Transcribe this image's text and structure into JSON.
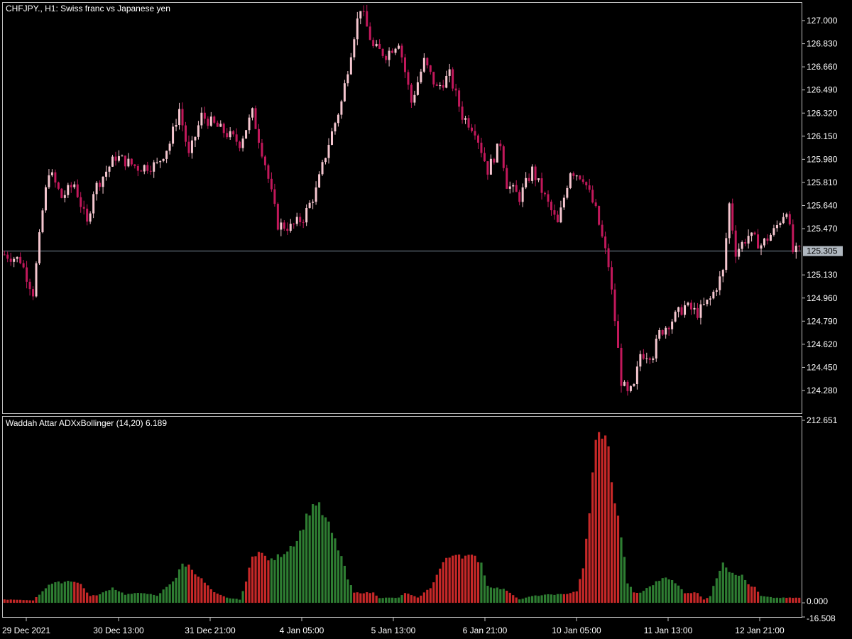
{
  "title": {
    "symbol": "CHFJPY.",
    "timeframe": "H1",
    "description": "Swiss franc vs Japanese yen"
  },
  "colors": {
    "background": "#000000",
    "bull_candle": "#F5C6CF",
    "bear_candle": "#C2185B",
    "histogram_up": "#2E7D32",
    "histogram_down": "#C62828",
    "price_line": "#7A8A9A",
    "current_price_bg": "#B0B8C0"
  },
  "current_price_label": "125.305",
  "chart_data": [
    {
      "type": "candlestick",
      "title": "CHFJPY., H1:  Swiss franc vs Japanese yen",
      "ylim": [
        124.15,
        127.1
      ],
      "y_ticks": [
        "127.000",
        "126.830",
        "126.660",
        "126.490",
        "126.320",
        "126.150",
        "125.980",
        "125.810",
        "125.640",
        "125.470",
        "125.130",
        "124.960",
        "124.790",
        "124.620",
        "124.450",
        "124.280"
      ],
      "x_ticks": [
        "29 Dec 2021",
        "30 Dec 13:00",
        "31 Dec 21:00",
        "4 Jan 05:00",
        "5 Jan 13:00",
        "6 Jan 21:00",
        "10 Jan 05:00",
        "11 Jan 13:00",
        "12 Jan 21:00"
      ],
      "current_price": 125.305,
      "close_path": [
        [
          0,
          125.28
        ],
        [
          5,
          125.24
        ],
        [
          9,
          125.0
        ],
        [
          12,
          125.6
        ],
        [
          14,
          125.9
        ],
        [
          18,
          125.7
        ],
        [
          22,
          125.8
        ],
        [
          26,
          125.5
        ],
        [
          28,
          125.75
        ],
        [
          35,
          126.0
        ],
        [
          42,
          125.92
        ],
        [
          48,
          125.94
        ],
        [
          52,
          126.1
        ],
        [
          55,
          126.35
        ],
        [
          58,
          126.0
        ],
        [
          62,
          126.3
        ],
        [
          68,
          126.2
        ],
        [
          74,
          126.1
        ],
        [
          78,
          126.32
        ],
        [
          82,
          125.95
        ],
        [
          86,
          125.5
        ],
        [
          90,
          125.48
        ],
        [
          94,
          125.55
        ],
        [
          98,
          125.75
        ],
        [
          102,
          126.1
        ],
        [
          106,
          126.4
        ],
        [
          110,
          126.9
        ],
        [
          112,
          127.1
        ],
        [
          116,
          126.8
        ],
        [
          120,
          126.75
        ],
        [
          124,
          126.85
        ],
        [
          128,
          126.4
        ],
        [
          132,
          126.7
        ],
        [
          136,
          126.5
        ],
        [
          140,
          126.6
        ],
        [
          144,
          126.3
        ],
        [
          148,
          126.2
        ],
        [
          152,
          125.9
        ],
        [
          156,
          126.1
        ],
        [
          158,
          125.8
        ],
        [
          162,
          125.7
        ],
        [
          166,
          125.9
        ],
        [
          170,
          125.7
        ],
        [
          174,
          125.5
        ],
        [
          178,
          125.9
        ],
        [
          182,
          125.85
        ],
        [
          186,
          125.6
        ],
        [
          190,
          125.2
        ],
        [
          192,
          124.8
        ],
        [
          194,
          124.35
        ],
        [
          196,
          124.25
        ],
        [
          198,
          124.3
        ],
        [
          200,
          124.55
        ],
        [
          204,
          124.55
        ],
        [
          206,
          124.7
        ],
        [
          210,
          124.8
        ],
        [
          214,
          124.9
        ],
        [
          218,
          124.85
        ],
        [
          222,
          124.95
        ],
        [
          226,
          125.15
        ],
        [
          228,
          125.65
        ],
        [
          230,
          125.3
        ],
        [
          234,
          125.42
        ],
        [
          238,
          125.35
        ],
        [
          242,
          125.45
        ],
        [
          246,
          125.62
        ],
        [
          248,
          125.3
        ],
        [
          250,
          125.3
        ]
      ]
    },
    {
      "type": "bar",
      "title": "Waddah Attar ADXxBollinger (14,20) 6.189",
      "ylim": [
        -16.508,
        212.651
      ],
      "y_ticks": [
        "212.651",
        "0.000",
        "-16.508"
      ],
      "last_value": 6.189,
      "envelope": [
        [
          0,
          4,
          -1
        ],
        [
          9,
          3,
          -1
        ],
        [
          11,
          10,
          1
        ],
        [
          14,
          22,
          1
        ],
        [
          20,
          26,
          1
        ],
        [
          22,
          26,
          -1
        ],
        [
          24,
          22,
          -1
        ],
        [
          27,
          8,
          -1
        ],
        [
          30,
          10,
          1
        ],
        [
          34,
          18,
          1
        ],
        [
          38,
          10,
          1
        ],
        [
          44,
          12,
          1
        ],
        [
          48,
          8,
          1
        ],
        [
          54,
          30,
          1
        ],
        [
          56,
          46,
          1
        ],
        [
          58,
          44,
          -1
        ],
        [
          62,
          28,
          -1
        ],
        [
          66,
          12,
          -1
        ],
        [
          70,
          6,
          1
        ],
        [
          74,
          4,
          1
        ],
        [
          76,
          24,
          -1
        ],
        [
          78,
          58,
          -1
        ],
        [
          80,
          60,
          -1
        ],
        [
          84,
          50,
          1
        ],
        [
          88,
          60,
          1
        ],
        [
          92,
          75,
          1
        ],
        [
          96,
          110,
          1
        ],
        [
          98,
          120,
          1
        ],
        [
          102,
          92,
          1
        ],
        [
          106,
          55,
          1
        ],
        [
          108,
          28,
          1
        ],
        [
          110,
          12,
          -1
        ],
        [
          116,
          12,
          -1
        ],
        [
          118,
          6,
          1
        ],
        [
          124,
          6,
          1
        ],
        [
          126,
          12,
          -1
        ],
        [
          130,
          6,
          -1
        ],
        [
          134,
          18,
          -1
        ],
        [
          138,
          48,
          -1
        ],
        [
          142,
          60,
          -1
        ],
        [
          144,
          56,
          -1
        ],
        [
          148,
          54,
          -1
        ],
        [
          150,
          48,
          1
        ],
        [
          152,
          20,
          1
        ],
        [
          158,
          15,
          -1
        ],
        [
          162,
          4,
          1
        ],
        [
          166,
          8,
          1
        ],
        [
          172,
          10,
          1
        ],
        [
          176,
          10,
          -1
        ],
        [
          180,
          14,
          -1
        ],
        [
          182,
          40,
          -1
        ],
        [
          184,
          110,
          -1
        ],
        [
          186,
          190,
          -1
        ],
        [
          188,
          205,
          -1
        ],
        [
          190,
          180,
          -1
        ],
        [
          192,
          120,
          -1
        ],
        [
          194,
          80,
          1
        ],
        [
          196,
          24,
          1
        ],
        [
          198,
          12,
          -1
        ],
        [
          200,
          12,
          1
        ],
        [
          204,
          22,
          1
        ],
        [
          208,
          32,
          1
        ],
        [
          212,
          20,
          1
        ],
        [
          214,
          12,
          -1
        ],
        [
          218,
          12,
          -1
        ],
        [
          220,
          4,
          -1
        ],
        [
          222,
          8,
          1
        ],
        [
          224,
          30,
          1
        ],
        [
          226,
          50,
          1
        ],
        [
          228,
          38,
          1
        ],
        [
          232,
          32,
          1
        ],
        [
          234,
          22,
          -1
        ],
        [
          236,
          18,
          -1
        ],
        [
          238,
          8,
          1
        ],
        [
          242,
          6,
          1
        ],
        [
          246,
          6,
          -1
        ],
        [
          250,
          6,
          -1
        ]
      ]
    }
  ]
}
